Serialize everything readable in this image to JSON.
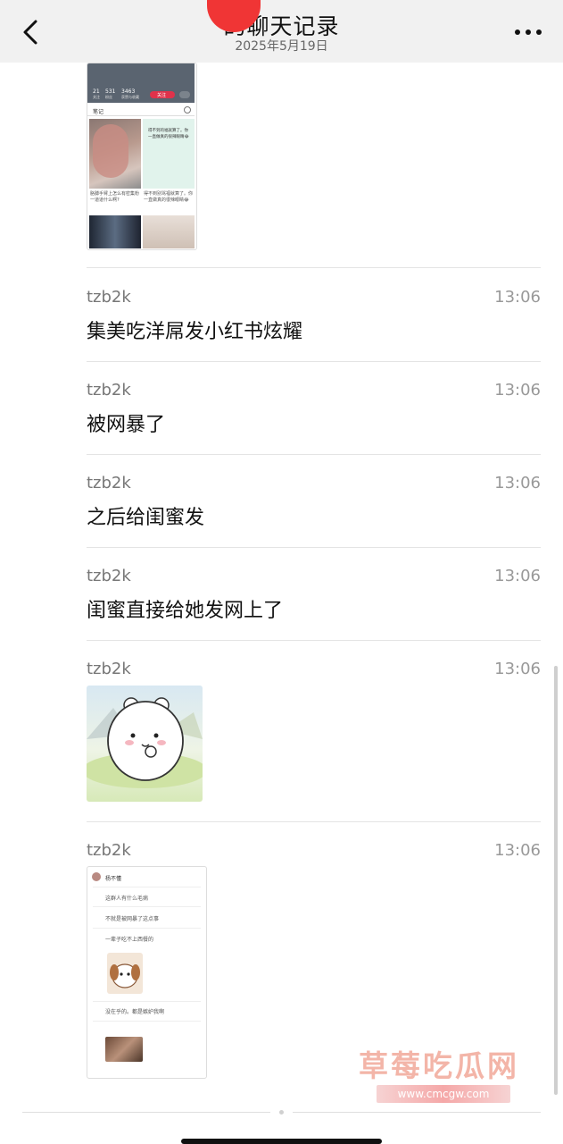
{
  "header": {
    "title": "的聊天记录",
    "date": "2025年5月19日"
  },
  "shared_image_top": {
    "stats": [
      "21",
      "531",
      "3463"
    ],
    "stat_labels": [
      "关注",
      "粉丝",
      "获赞与收藏"
    ],
    "follow_label": "关注",
    "tab_label": "笔记",
    "note1_caption": "胳膊手臂上怎么有密集粉一道道什么啊?",
    "note2_text": "得不到的福就算了。你一直做真的很辣眼睛😂",
    "note2_caption": "得不到别骂福就算了。你一直做真的很辣眼睛😂"
  },
  "messages": [
    {
      "sender": "tzb2k",
      "time": "13:06",
      "text": "集美吃洋屌发小红书炫耀"
    },
    {
      "sender": "tzb2k",
      "time": "13:06",
      "text": "被网暴了"
    },
    {
      "sender": "tzb2k",
      "time": "13:06",
      "text": "之后给闺蜜发"
    },
    {
      "sender": "tzb2k",
      "time": "13:06",
      "text": "闺蜜直接给她发网上了"
    },
    {
      "sender": "tzb2k",
      "time": "13:06",
      "type": "sticker"
    },
    {
      "sender": "tzb2k",
      "time": "13:06",
      "type": "image"
    }
  ],
  "chat_shot": {
    "name": "杨不懂",
    "lines": [
      "这群人有什么毛病",
      "不就是被网暴了这点事",
      "一辈子吃不上西餐的",
      "没在乎的。都是嫉妒我啊"
    ]
  },
  "watermark": {
    "text": "草莓吃瓜网",
    "url": "www.cmcgw.com"
  },
  "colors": {
    "header_bg": "#f1f1f1",
    "follow_red": "#e0324b",
    "redaction": "#f03535"
  }
}
